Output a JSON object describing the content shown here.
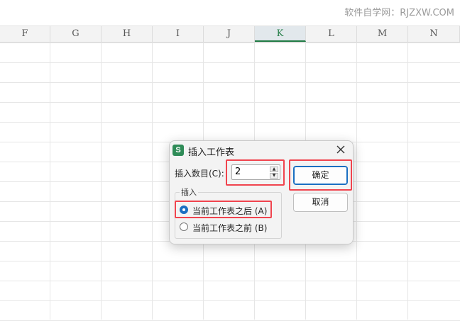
{
  "watermark": "软件自学网：RJZXW.COM",
  "columns": [
    {
      "label": "F"
    },
    {
      "label": "G"
    },
    {
      "label": "H"
    },
    {
      "label": "I"
    },
    {
      "label": "J"
    },
    {
      "label": "K"
    },
    {
      "label": "L"
    },
    {
      "label": "M"
    },
    {
      "label": "N"
    }
  ],
  "active_column": "K",
  "dialog": {
    "app_icon_letter": "S",
    "title": "插入工作表",
    "count_label": "插入数目(C):",
    "count_value": "2",
    "group_label": "插入",
    "option_after": "当前工作表之后 (A)",
    "option_before": "当前工作表之前 (B)",
    "selected_option": "after",
    "ok_label": "确定",
    "cancel_label": "取消"
  },
  "colors": {
    "accent": "#1a6fc2",
    "highlight": "#f0444e",
    "app_green": "#2e8b57",
    "active_col": "#1f7a43"
  }
}
